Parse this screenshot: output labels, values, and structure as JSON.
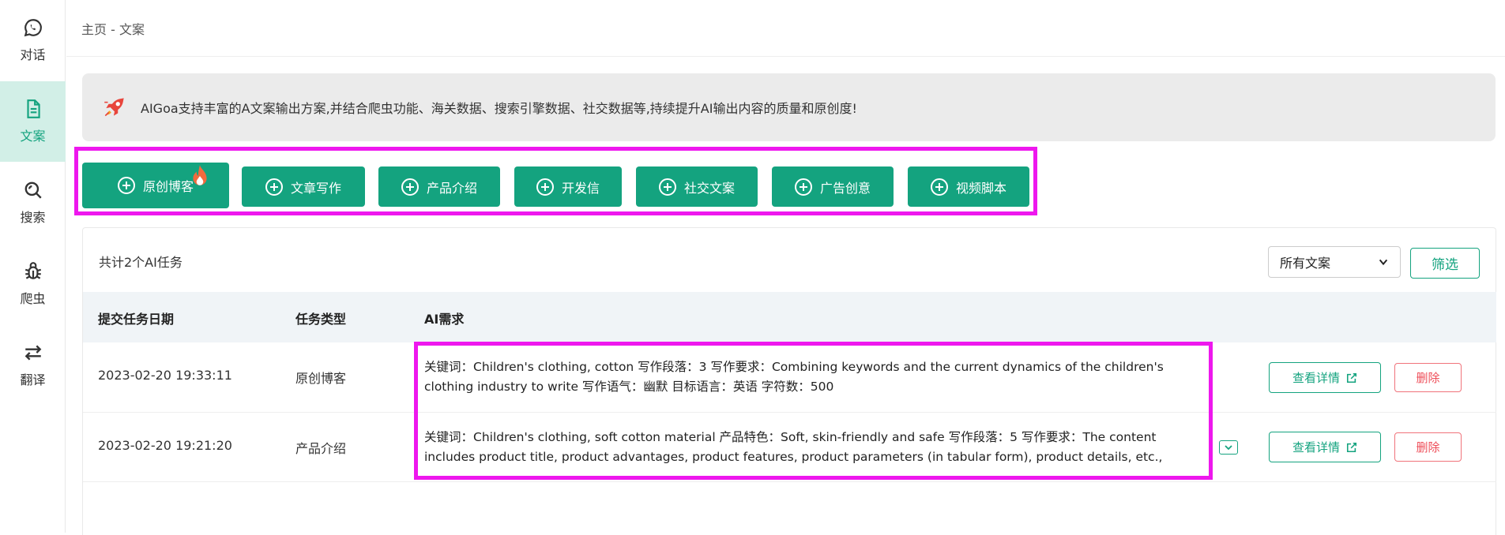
{
  "sidebar": {
    "items": [
      {
        "label": "对话",
        "icon": "chat-icon",
        "active": false
      },
      {
        "label": "文案",
        "icon": "document-icon",
        "active": true
      },
      {
        "label": "搜索",
        "icon": "search-icon",
        "active": false
      },
      {
        "label": "爬虫",
        "icon": "bug-icon",
        "active": false
      },
      {
        "label": "翻译",
        "icon": "swap-icon",
        "active": false
      }
    ]
  },
  "breadcrumb": "主页 - 文案",
  "notice": {
    "icon": "rocket-icon",
    "text": "AIGoa支持丰富的A文案输出方案,并结合爬虫功能、海关数据、搜索引擎数据、社交数据等,持续提升AI输出内容的质量和原创度!"
  },
  "templates": [
    {
      "label": "原创博客",
      "hot": true
    },
    {
      "label": "文章写作"
    },
    {
      "label": "产品介绍"
    },
    {
      "label": "开发信"
    },
    {
      "label": "社交文案"
    },
    {
      "label": "广告创意"
    },
    {
      "label": "视频脚本"
    }
  ],
  "tasks": {
    "count_text": "共计2个AI任务",
    "filter_value": "所有文案",
    "filter_button": "筛选",
    "columns": [
      "提交任务日期",
      "任务类型",
      "AI需求"
    ],
    "rows": [
      {
        "date": "2023-02-20 19:33:11",
        "type": "原创博客",
        "requirement": "关键词：Children's clothing, cotton 写作段落：3 写作要求：Combining keywords and the current dynamics of the children's clothing industry to write 写作语气：幽默 目标语言：英语 字符数：500",
        "detail_label": "查看详情",
        "delete_label": "删除"
      },
      {
        "date": "2023-02-20 19:21:20",
        "type": "产品介绍",
        "requirement": "关键词：Children's clothing, soft cotton material 产品特色：Soft, skin-friendly and safe 写作段落：5 写作要求：The content includes product title, product advantages, product features, product parameters (in tabular form), product details, etc., and",
        "detail_label": "查看详情",
        "delete_label": "删除"
      }
    ]
  },
  "colors": {
    "primary": "#14a37f",
    "active_bg": "#d2efe7",
    "danger": "#ee4d58",
    "highlight": "#ee17ee"
  }
}
